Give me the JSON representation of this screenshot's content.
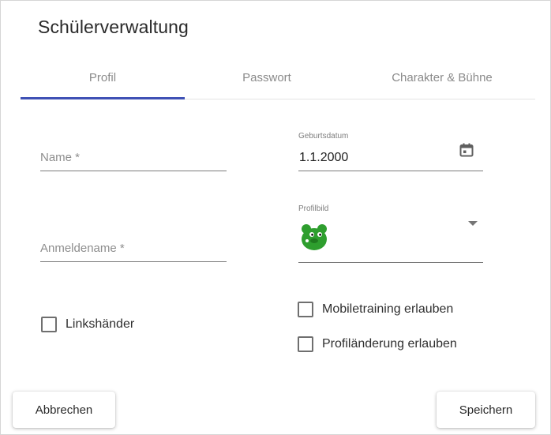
{
  "dialog": {
    "title": "Schülerverwaltung"
  },
  "tabs": [
    {
      "label": "Profil",
      "active": true
    },
    {
      "label": "Passwort",
      "active": false
    },
    {
      "label": "Charakter & Bühne",
      "active": false
    }
  ],
  "colors": {
    "accent": "#3f51b5",
    "avatar": "#2e9e2e"
  },
  "form": {
    "name": {
      "placeholder": "Name *",
      "value": ""
    },
    "login": {
      "placeholder": "Anmeldename *",
      "value": ""
    },
    "birthdate": {
      "label": "Geburtsdatum",
      "value": "1.1.2000",
      "icon": "calendar-icon"
    },
    "avatar": {
      "label": "Profilbild",
      "selected_icon": "green-bear-avatar",
      "dropdown_icon": "caret-down-icon"
    },
    "left_handed": {
      "label": "Linkshänder",
      "checked": false
    },
    "mobile_training": {
      "label": "Mobiletraining erlauben",
      "checked": false
    },
    "profile_change": {
      "label": "Profiländerung erlauben",
      "checked": false
    }
  },
  "actions": {
    "cancel": "Abbrechen",
    "save": "Speichern"
  }
}
